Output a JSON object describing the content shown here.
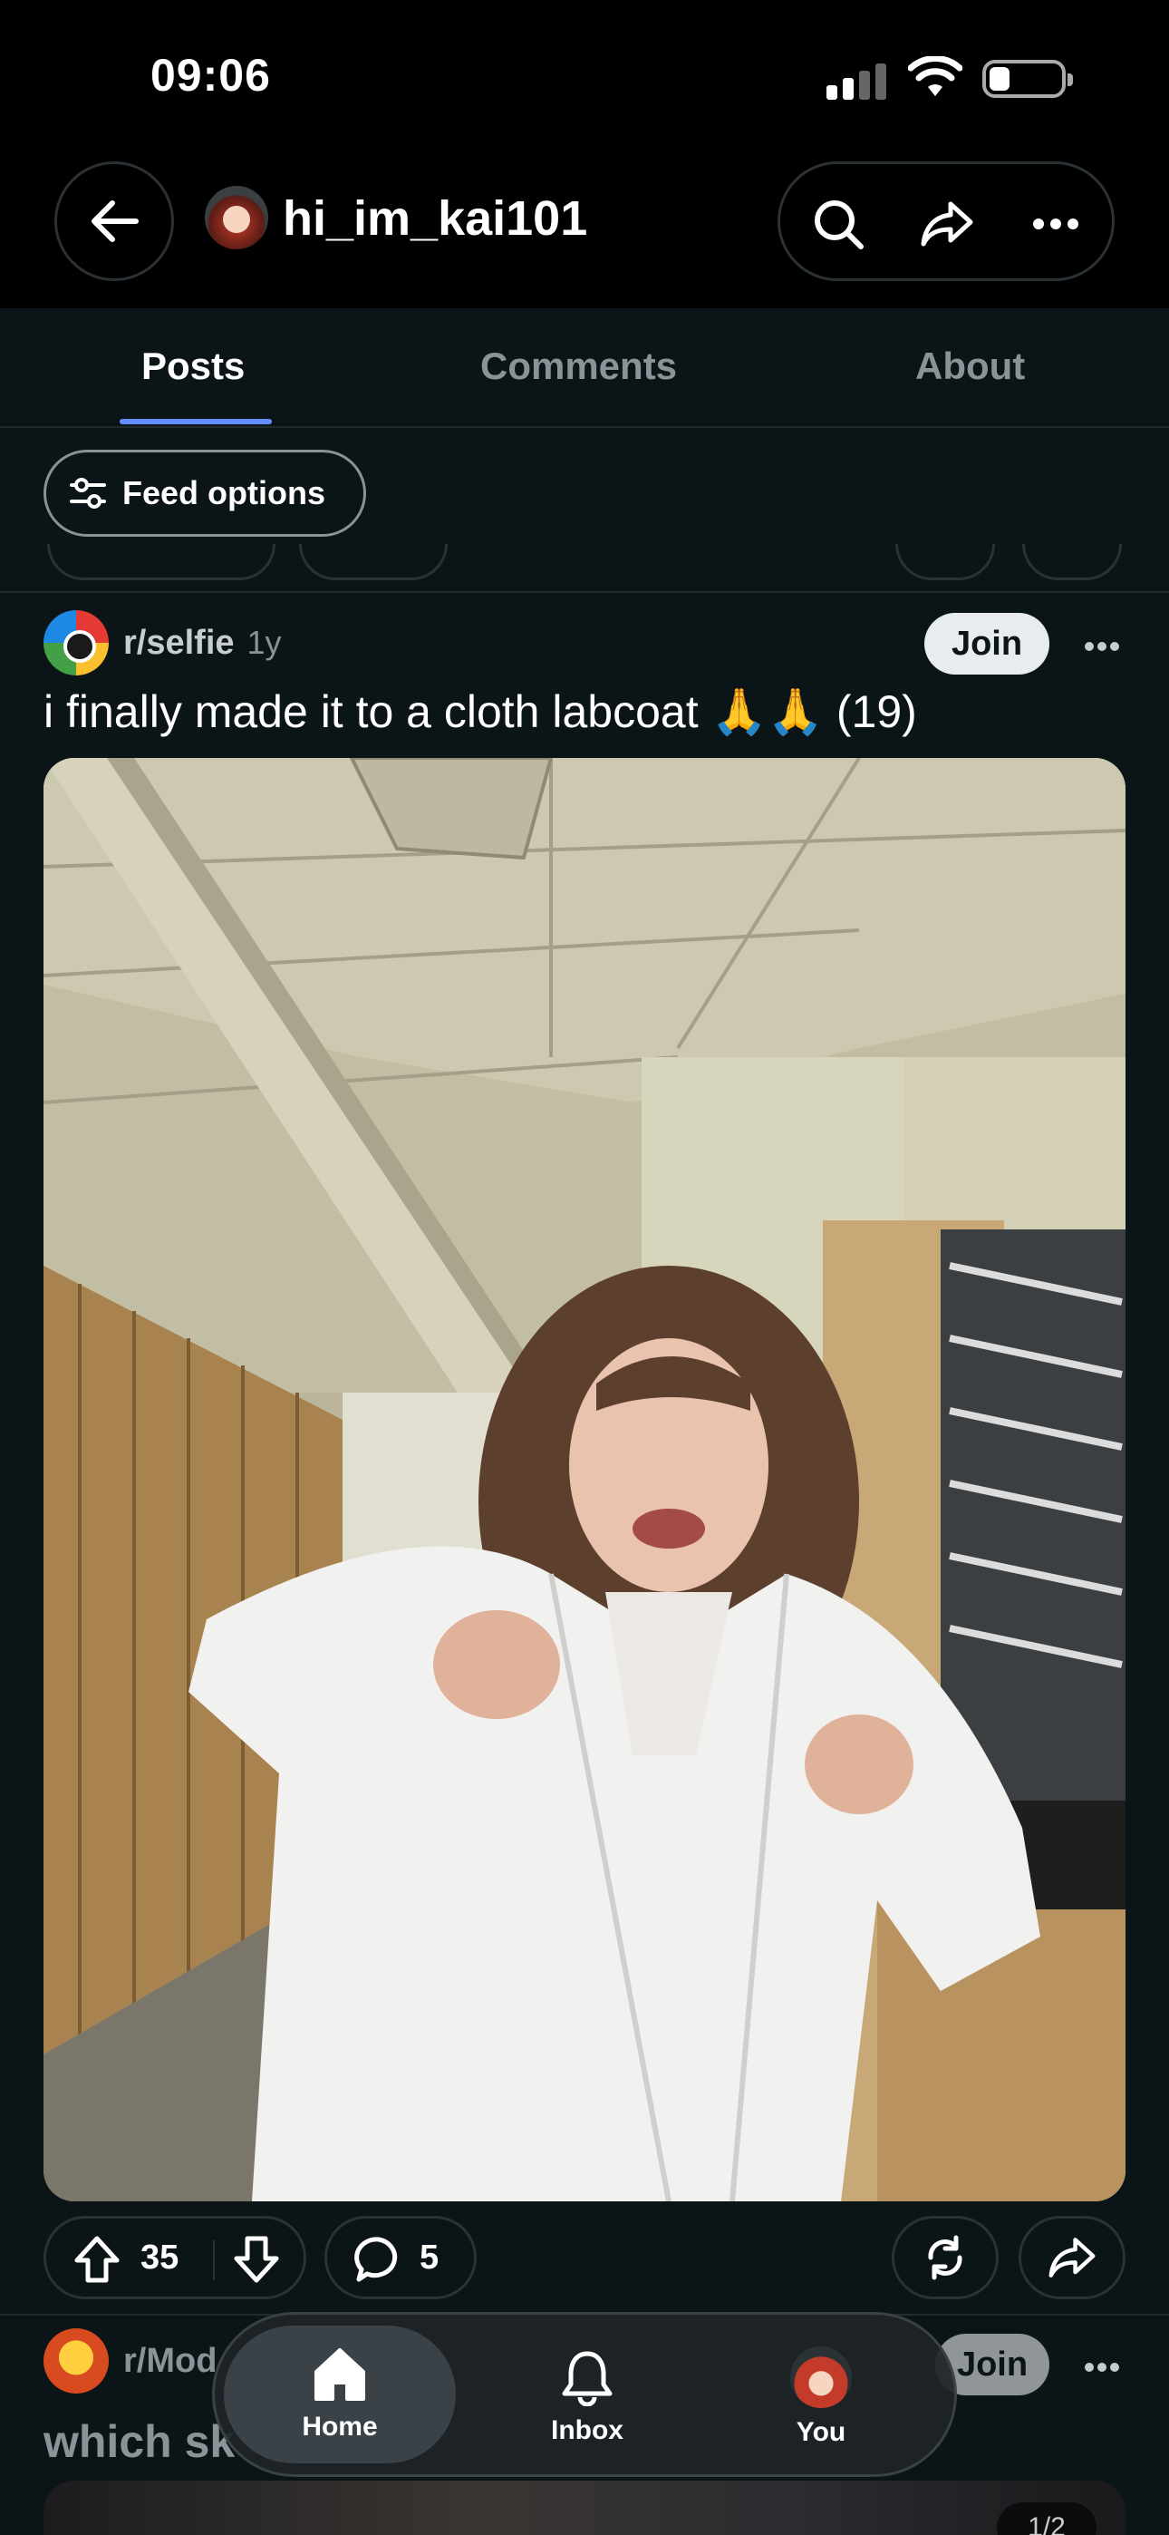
{
  "status_bar": {
    "time": "09:06"
  },
  "header": {
    "username": "hi_im_kai101",
    "icons": [
      "back-arrow-icon",
      "search-icon",
      "share-icon",
      "more-icon"
    ]
  },
  "tabs": [
    {
      "label": "Posts",
      "active": true
    },
    {
      "label": "Comments",
      "active": false
    },
    {
      "label": "About",
      "active": false
    }
  ],
  "feed_options": {
    "label": "Feed options"
  },
  "post": {
    "subreddit": "r/selfie",
    "age": "1y",
    "join_label": "Join",
    "title": "i finally made it to a cloth labcoat 🙏🙏 (19)",
    "upvotes": "35",
    "comments": "5"
  },
  "next_post": {
    "subreddit": "r/Mod",
    "join_label": "Join",
    "title": "which sk",
    "page_indicator": "1/2"
  },
  "bottom_nav": [
    {
      "label": "Home",
      "icon": "home-icon",
      "active": true
    },
    {
      "label": "Inbox",
      "icon": "bell-icon",
      "active": false
    },
    {
      "label": "You",
      "icon": "avatar",
      "active": false
    }
  ],
  "colors": {
    "background": "#0b1416",
    "accent": "#648efc",
    "join_bg": "#e9ecee"
  }
}
